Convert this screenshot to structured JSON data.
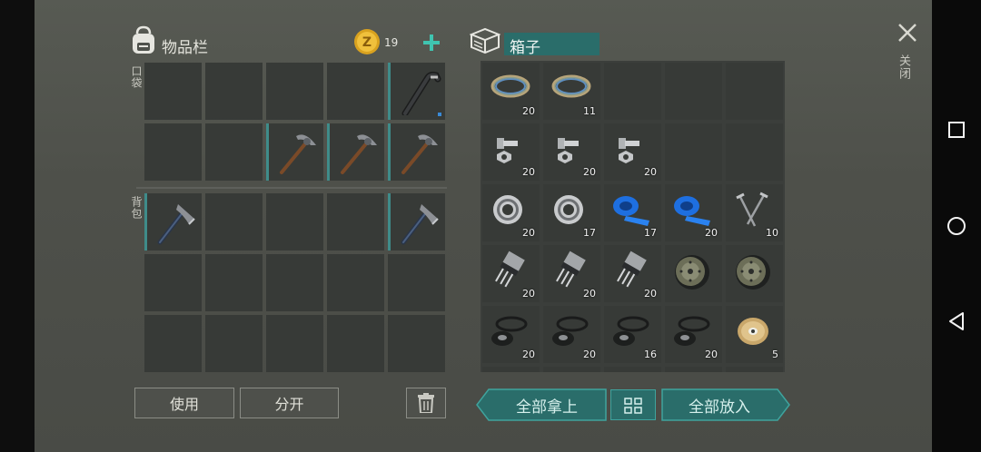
{
  "inventory": {
    "title": "物品栏",
    "coins": "19",
    "pocket_label": "口袋",
    "backpack_label": "背包",
    "use_label": "使用",
    "split_label": "分开"
  },
  "box": {
    "title": "箱子",
    "take_all_label": "全部拿上",
    "put_all_label": "全部放入"
  },
  "close": {
    "label": "关闭"
  },
  "box_counts": {
    "r0": [
      "20",
      "11"
    ],
    "r1": [
      "20",
      "20",
      "20"
    ],
    "r2": [
      "20",
      "17",
      "17",
      "20",
      "10"
    ],
    "r3": [
      "20",
      "20",
      "20"
    ],
    "r4": [
      "20",
      "20",
      "16",
      "20",
      "5"
    ]
  },
  "colors": {
    "accent": "#2a6d6a",
    "slot": "#373a37",
    "selected_border": "#3f8c8a",
    "tape_blue": "#1e6fe0"
  },
  "icons": {
    "inventory": "backpack-icon",
    "coin": "coin-icon",
    "add": "plus-icon",
    "box": "box-icon",
    "close": "close-icon",
    "trash": "trash-icon",
    "sort": "grid-sort-icon"
  }
}
